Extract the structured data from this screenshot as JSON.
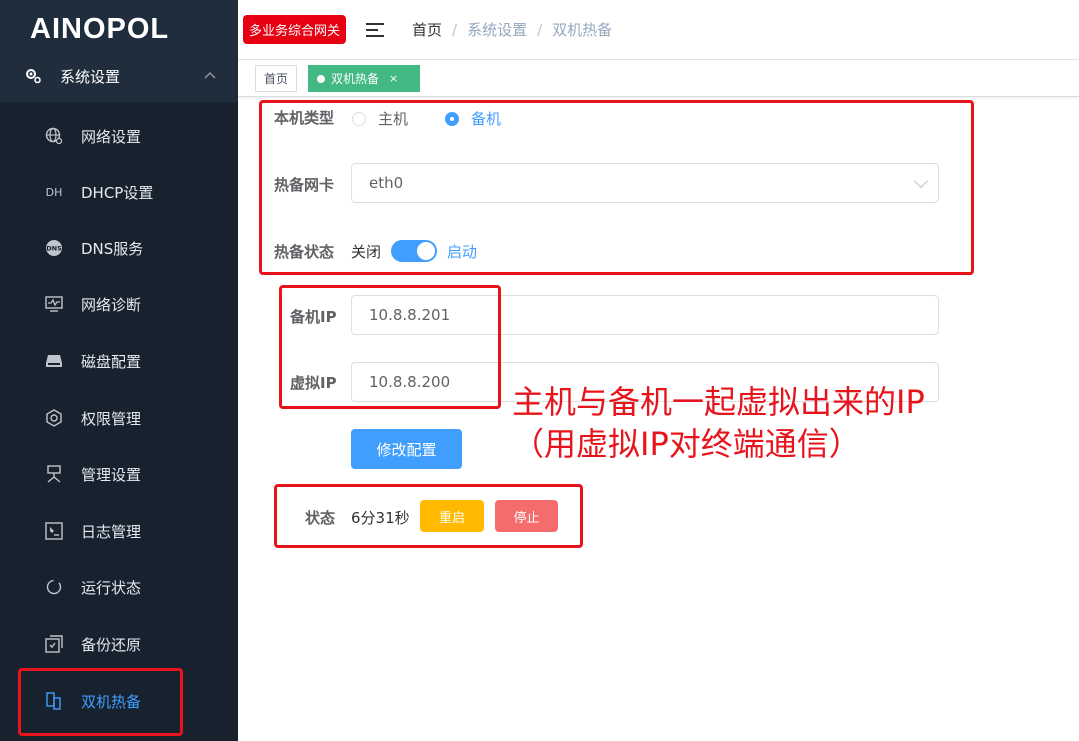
{
  "sidebar": {
    "logo": "AINOPOL",
    "parent": {
      "label": "系统设置",
      "icon": "gear-icon"
    },
    "items": [
      {
        "label": "网络设置",
        "icon": "globe-gear-icon"
      },
      {
        "label": "DHCP设置",
        "icon_text": "DH"
      },
      {
        "label": "DNS服务",
        "icon_text": "DNS"
      },
      {
        "label": "网络诊断",
        "icon": "monitor-pulse-icon"
      },
      {
        "label": "磁盘配置",
        "icon": "disk-icon"
      },
      {
        "label": "权限管理",
        "icon": "hexagon-icon"
      },
      {
        "label": "管理设置",
        "icon": "admin-icon"
      },
      {
        "label": "日志管理",
        "icon": "log-icon"
      },
      {
        "label": "运行状态",
        "icon": "refresh-icon"
      },
      {
        "label": "备份还原",
        "icon": "backup-icon"
      },
      {
        "label": "双机热备",
        "icon": "dual-machine-icon"
      }
    ]
  },
  "header": {
    "badge": "多业务综合网关",
    "breadcrumb": [
      "首页",
      "系统设置",
      "双机热备"
    ]
  },
  "tags": [
    {
      "label": "首页"
    },
    {
      "label": "双机热备",
      "close": "×"
    }
  ],
  "form": {
    "machine_type": {
      "label": "本机类型",
      "options": [
        "主机",
        "备机"
      ],
      "selected": "备机"
    },
    "nic": {
      "label": "热备网卡",
      "value": "eth0"
    },
    "hot_standby": {
      "label": "热备状态",
      "off_text": "关闭",
      "on_text": "启动",
      "enabled": true
    },
    "backup_ip": {
      "label": "备机IP",
      "value": "10.8.8.201"
    },
    "virtual_ip": {
      "label": "虚拟IP",
      "value": "10.8.8.200"
    },
    "submit": "修改配置",
    "status": {
      "label": "状态",
      "value": "6分31秒",
      "restart": "重启",
      "stop": "停止"
    }
  },
  "annotation": {
    "line1": "主机与备机一起虚拟出来的IP",
    "line2": "（用虚拟IP对终端通信）"
  },
  "colors": {
    "primary": "#409eff",
    "tag_active": "#42b983",
    "warning": "#ffba00",
    "danger": "#f56c6c",
    "annotation": "#e8141c"
  }
}
